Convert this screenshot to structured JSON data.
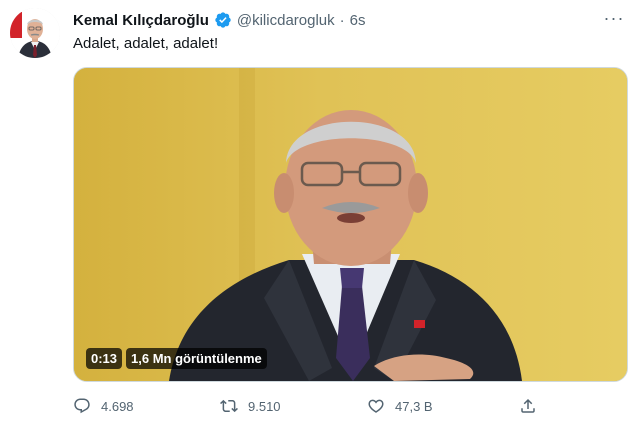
{
  "tweet": {
    "author_name": "Kemal Kılıçdaroğlu",
    "handle": "@kilicdarogluk",
    "separator": "·",
    "time": "6s",
    "more_label": "···",
    "text": "Adalet, adalet, adalet!",
    "avatar_icon": "profile-photo",
    "verified_color": "#1d9bf0"
  },
  "video": {
    "duration": "0:13",
    "views": "1,6 Mn görüntülenme"
  },
  "actions": {
    "reply_count": "4.698",
    "retweet_count": "9.510",
    "like_count": "47,3 B",
    "icons": [
      "reply-icon",
      "retweet-icon",
      "like-icon",
      "share-icon"
    ]
  },
  "colors": {
    "text_primary": "#0f1419",
    "text_secondary": "#536471",
    "video_background": "#d9b84a"
  }
}
